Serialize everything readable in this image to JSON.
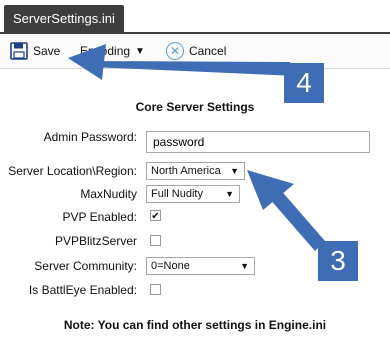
{
  "tab": {
    "title": "ServerSettings.ini"
  },
  "toolbar": {
    "save_label": "Save",
    "encoding_label": "Encoding",
    "cancel_label": "Cancel"
  },
  "panel": {
    "heading": "Core Server Settings",
    "fields": {
      "admin_password": {
        "label": "Admin Password:",
        "value": "password"
      },
      "server_location": {
        "label": "Server Location\\Region:",
        "value": "North America"
      },
      "max_nudity": {
        "label": "MaxNudity",
        "value": "Full Nudity"
      },
      "pvp_enabled": {
        "label": "PVP Enabled:",
        "checked": true
      },
      "pvp_blitz": {
        "label": "PVPBlitzServer",
        "checked": false
      },
      "server_community": {
        "label": "Server Community:",
        "value": "0=None"
      },
      "battleye": {
        "label": "Is BattlEye Enabled:",
        "checked": false
      }
    },
    "note": "Note: You can find other settings in Engine.ini"
  },
  "annotations": {
    "badge_4": "4",
    "badge_3": "3",
    "color": "#3f6db5"
  }
}
